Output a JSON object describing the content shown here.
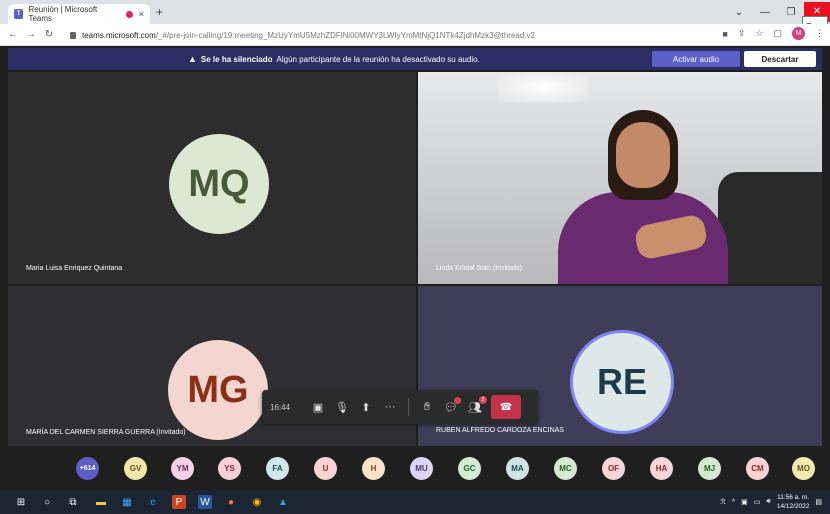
{
  "browser": {
    "tab_title": "Reunión | Microsoft Teams",
    "tab_close": "×",
    "new_tab": "+",
    "close_tooltip": "Cerrar",
    "url_host": "teams.microsoft.com",
    "url_path": "/_#/pre-join-calling/19:meeting_MzUyYmU5MzhZDFlNi00MWY3LWIyYmMtNjQ1NTk4ZjdhMzk3@thread.v2",
    "profile_initial": "M"
  },
  "banner": {
    "bold": "Se le ha silenciado",
    "message": "Algún participante de la reunión ha desactivado su audio.",
    "activate_label": "Activar audio",
    "dismiss_label": "Descartar"
  },
  "tiles": [
    {
      "initials": "MQ",
      "name": "Maria Luisa Enriquez Quintana"
    },
    {
      "name": "Linda Kristal Soto (Invitado)"
    },
    {
      "initials": "MG",
      "name": "MARÍA DEL CARMEN SIERRA GUERRA (Invitado)"
    },
    {
      "initials": "RE",
      "name": "RUBEN ALFREDO CARDOZA ENCINAS"
    }
  ],
  "callbar": {
    "timer": "16:44",
    "chat_badge": "",
    "people_badge": "2"
  },
  "participants": [
    {
      "initials": "+614",
      "bg": "#5b5fc7",
      "fg": "#ffffff"
    },
    {
      "initials": "GV",
      "bg": "#f2e6a8",
      "fg": "#5d5420"
    },
    {
      "initials": "YM",
      "bg": "#f3d1e7",
      "fg": "#7a2a5e"
    },
    {
      "initials": "YS",
      "bg": "#f5d0d8",
      "fg": "#8a2a3e"
    },
    {
      "initials": "FA",
      "bg": "#cfe6ea",
      "fg": "#1d4c55"
    },
    {
      "initials": "U",
      "bg": "#f7d4d4",
      "fg": "#8a2a2a"
    },
    {
      "initials": "H",
      "bg": "#fbe3c8",
      "fg": "#7a4a10"
    },
    {
      "initials": "MU",
      "bg": "#dcd6f2",
      "fg": "#423a7a"
    },
    {
      "initials": "GC",
      "bg": "#d1ead3",
      "fg": "#2a5e30"
    },
    {
      "initials": "MA",
      "bg": "#cfe3e6",
      "fg": "#1d4a55"
    },
    {
      "initials": "MC",
      "bg": "#d6e8d4",
      "fg": "#2f5a2c"
    },
    {
      "initials": "OF",
      "bg": "#f7d6d8",
      "fg": "#8a2a34"
    },
    {
      "initials": "HA",
      "bg": "#f8d5d7",
      "fg": "#8a2a30"
    },
    {
      "initials": "MJ",
      "bg": "#d3e8d2",
      "fg": "#2c5a2a"
    },
    {
      "initials": "CM",
      "bg": "#f7d2d2",
      "fg": "#8a2a2a"
    },
    {
      "initials": "MO",
      "bg": "#f2eab0",
      "fg": "#5d5420"
    }
  ],
  "taskbar": {
    "time": "11:56 a. m.",
    "date": "14/12/2022"
  },
  "colors": {
    "banner_bg": "#2b2e63",
    "accent": "#5b5fc7",
    "hangup": "#c4314b"
  }
}
